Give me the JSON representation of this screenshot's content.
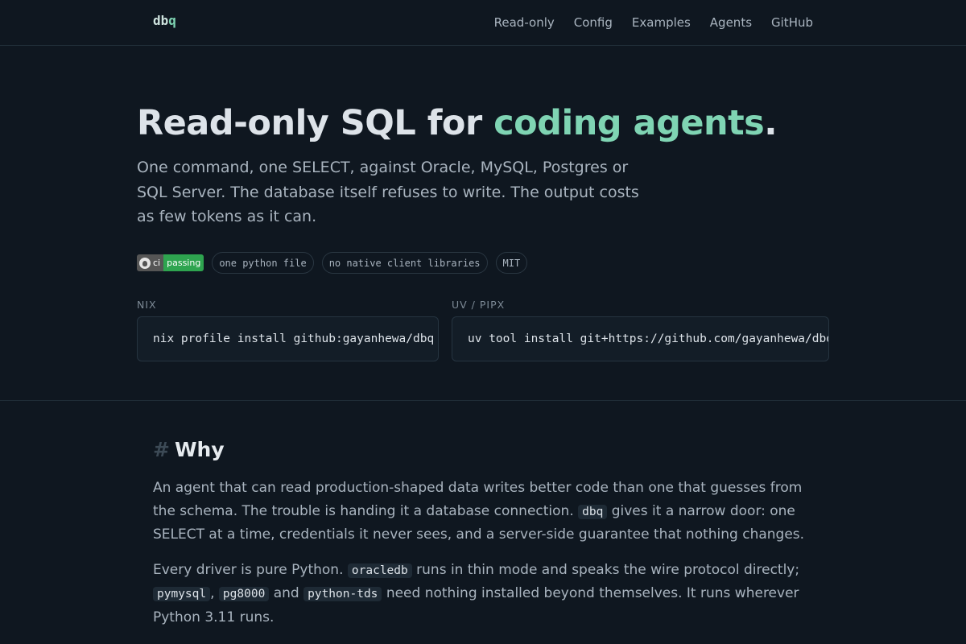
{
  "brand": {
    "prefix": "db",
    "accent": "q"
  },
  "nav": [
    "Read-only",
    "Config",
    "Examples",
    "Agents",
    "GitHub"
  ],
  "hero": {
    "title_plain": "Read-only SQL for ",
    "title_accent": "coding agents",
    "title_end": ".",
    "lede": "One command, one SELECT, against Oracle, MySQL, Postgres or SQL Server. The database itself refuses to write. The output costs as few tokens as it can."
  },
  "badges": {
    "ci_label": "ci",
    "ci_status": "passing",
    "pills": [
      "one python file",
      "no native client libraries",
      "MIT"
    ]
  },
  "install": {
    "nix_label": "NIX",
    "nix_cmd": "nix profile install github:gayanhewa/dbq",
    "uv_label": "UV / PIPX",
    "uv_cmd": "uv tool install git+https://github.com/gayanhewa/dbq"
  },
  "why": {
    "hash": "#",
    "heading": "Why",
    "p1_a": "An agent that can read production-shaped data writes better code than one that guesses from the schema. The trouble is handing it a database connection. ",
    "p1_code": "dbq",
    "p1_b": " gives it a narrow door: one SELECT at a time, credentials it never sees, and a server-side guarantee that nothing changes.",
    "p2_a": "Every driver is pure Python. ",
    "p2_code1": "oracledb",
    "p2_b": " runs in thin mode and speaks the wire protocol directly; ",
    "p2_code2": "pymysql",
    "p2_c": ", ",
    "p2_code3": "pg8000",
    "p2_d": " and ",
    "p2_code4": "python-tds",
    "p2_e": " need nothing installed beyond themselves. It runs wherever Python 3.11 runs."
  },
  "colors": {
    "background": "#0f1720",
    "accent": "#7fd4b3",
    "ci_green": "#2ea44f"
  }
}
